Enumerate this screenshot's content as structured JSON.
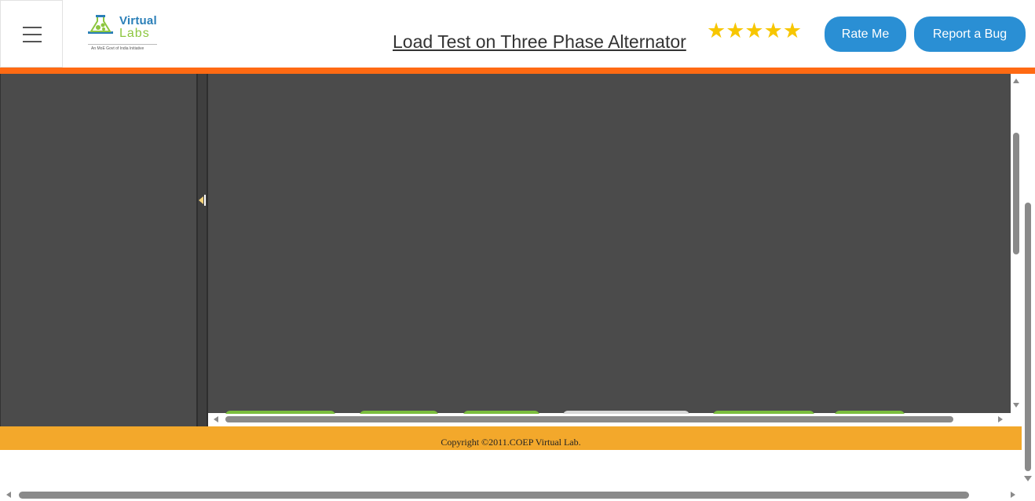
{
  "header": {
    "title": "Load Test on Three Phase Alternator",
    "logo": {
      "line1": "Virtual",
      "line2": "Labs",
      "tagline": "An MoE Govt of India Initiative"
    },
    "rating": {
      "stars": 5,
      "glyph": "★★★★★",
      "color": "#f7c600"
    },
    "rate_button": "Rate Me",
    "bug_button": "Report a Bug"
  },
  "colors": {
    "accent_bar": "#ff6a13",
    "footer": "#f3a82b",
    "button": "#2a8fd4",
    "workspace": "#4b4b4b",
    "tab_green": "#7bbd3e"
  },
  "icons": {
    "menu": "hamburger-icon",
    "logo": "flask-icon",
    "collapse": "collapse-left-icon"
  },
  "footer": {
    "copyright": "Copyright ©2011.COEP Virtual Lab."
  }
}
